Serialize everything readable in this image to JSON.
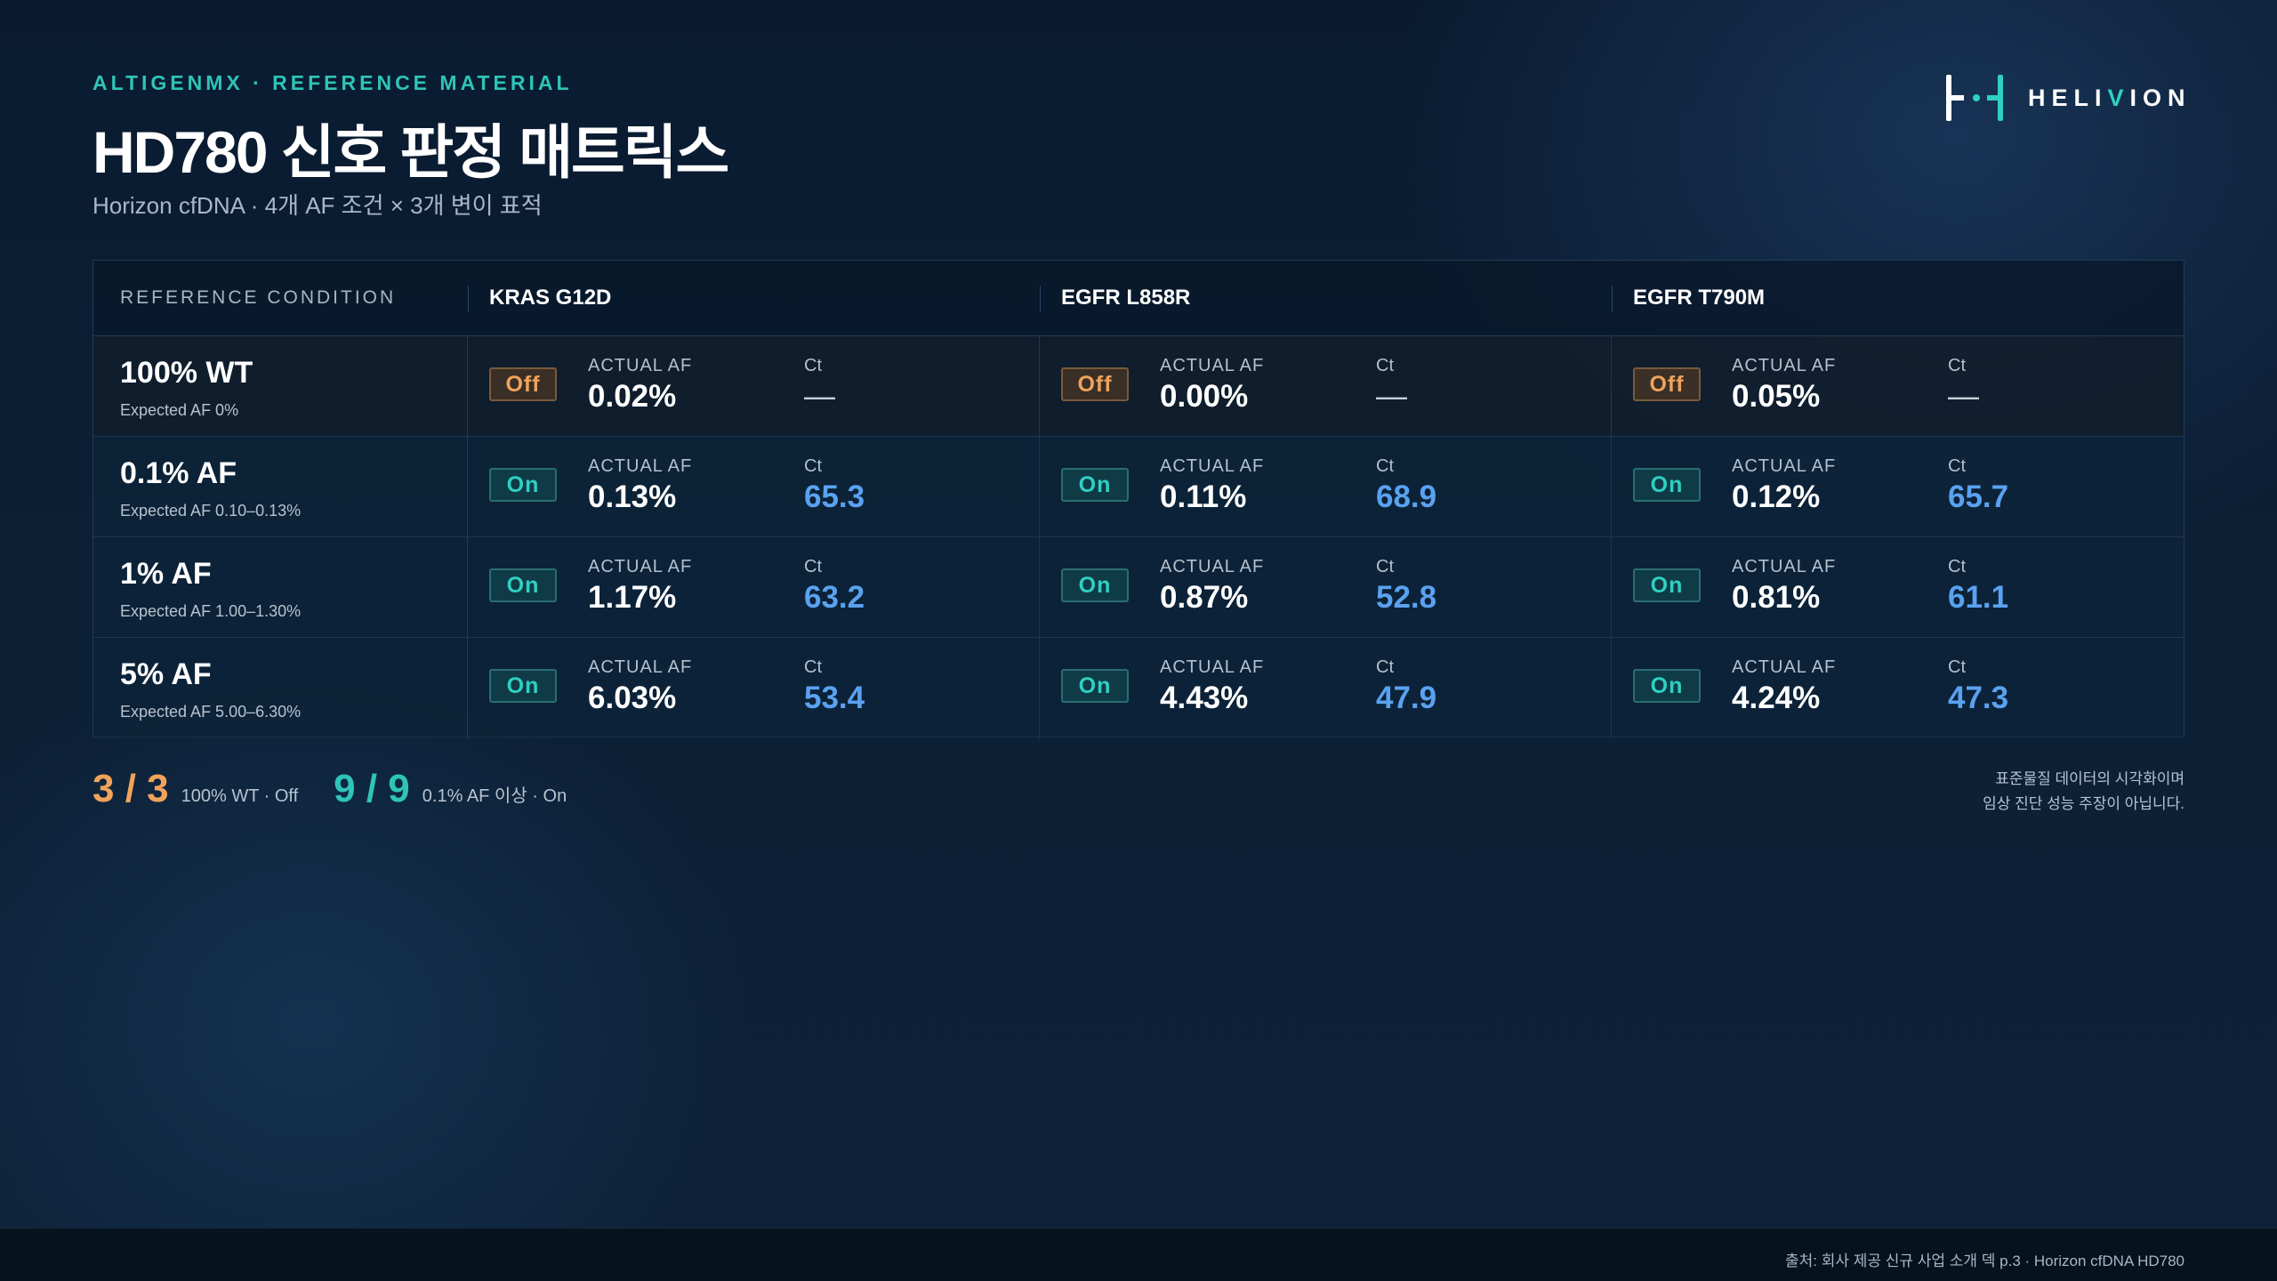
{
  "header": {
    "eyebrow": "ALTIGENMX · REFERENCE MATERIAL",
    "title": "HD780 신호 판정 매트릭스",
    "subtitle": "Horizon cfDNA · 4개 AF 조건 × 3개 변이 표적"
  },
  "logo": {
    "text_before": "HELI",
    "text_accent": "V",
    "text_after": "ION",
    "icon": "helivion-logo-icon",
    "accent_color": "#2fd0c2"
  },
  "matrix": {
    "header": {
      "condition": "REFERENCE CONDITION",
      "variants": [
        "KRAS G12D",
        "EGFR L858R",
        "EGFR T790M"
      ]
    },
    "labels": {
      "af": "ACTUAL AF",
      "ct": "Ct"
    },
    "rows": [
      {
        "title": "100% WT",
        "expected": "Expected AF 0%",
        "cells": [
          {
            "state": "Off",
            "af": "0.02%",
            "ct": "—"
          },
          {
            "state": "Off",
            "af": "0.00%",
            "ct": "—"
          },
          {
            "state": "Off",
            "af": "0.05%",
            "ct": "—"
          }
        ]
      },
      {
        "title": "0.1% AF",
        "expected": "Expected AF 0.10–0.13%",
        "cells": [
          {
            "state": "On",
            "af": "0.13%",
            "ct": "65.3"
          },
          {
            "state": "On",
            "af": "0.11%",
            "ct": "68.9"
          },
          {
            "state": "On",
            "af": "0.12%",
            "ct": "65.7"
          }
        ]
      },
      {
        "title": "1% AF",
        "expected": "Expected AF 1.00–1.30%",
        "cells": [
          {
            "state": "On",
            "af": "1.17%",
            "ct": "63.2"
          },
          {
            "state": "On",
            "af": "0.87%",
            "ct": "52.8"
          },
          {
            "state": "On",
            "af": "0.81%",
            "ct": "61.1"
          }
        ]
      },
      {
        "title": "5% AF",
        "expected": "Expected AF 5.00–6.30%",
        "cells": [
          {
            "state": "On",
            "af": "6.03%",
            "ct": "53.4"
          },
          {
            "state": "On",
            "af": "4.43%",
            "ct": "47.9"
          },
          {
            "state": "On",
            "af": "4.24%",
            "ct": "47.3"
          }
        ]
      }
    ]
  },
  "summary": {
    "off_count": "3 / 3",
    "off_label": "100% WT · Off",
    "on_count": "9 / 9",
    "on_label": "0.1% AF 이상 · On"
  },
  "disclaimer": {
    "line1": "표준물질 데이터의 시각화이며",
    "line2": "임상 진단 성능 주장이 아닙니다."
  },
  "footer": {
    "source": "출처: 회사 제공 신규 사업 소개 덱 p.3 · Horizon cfDNA HD780"
  },
  "colors": {
    "off": "#f0a35a",
    "on": "#2fd0c2",
    "ct": "#5aa2f0",
    "background": "#0c2036"
  }
}
